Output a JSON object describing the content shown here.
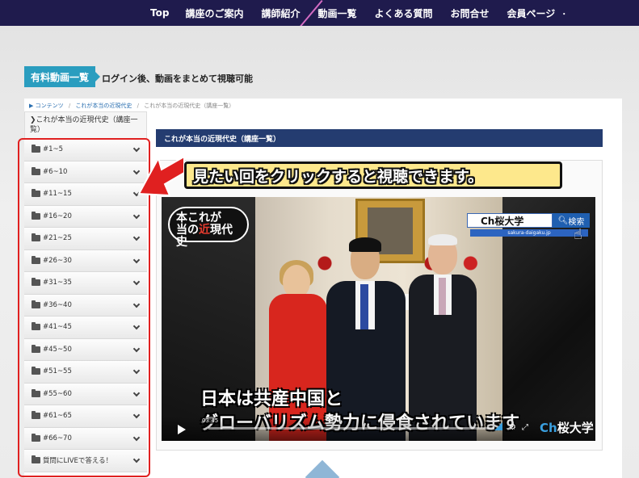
{
  "nav": {
    "items": [
      "Top",
      "講座のご案内",
      "講師紹介",
      "動画一覧",
      "よくある質問",
      "お問合せ",
      "会員ページ"
    ],
    "dot": "・"
  },
  "header": {
    "badge": "有料動画一覧",
    "headline": "ログイン後、動画をまとめて視聴可能"
  },
  "breadcrumb": {
    "home": "▶ コンテンツ",
    "sep": "/",
    "parent": "これが本当の近現代史",
    "current": "これが本当の近現代史（講座一覧）"
  },
  "sidebar": {
    "heading": "❯これが本当の近現代史（講座一覧）",
    "items": [
      "#1~5",
      "#6~10",
      "#11~15",
      "#16~20",
      "#21~25",
      "#26~30",
      "#31~35",
      "#36~40",
      "#41~45",
      "#45~50",
      "#51~55",
      "#55~60",
      "#61~65",
      "#66~70",
      "質問にLIVEで答える！"
    ]
  },
  "main": {
    "title": "これが本当の近現代史（講座一覧）",
    "callout": "見たい回をクリックすると視聴できます。"
  },
  "video": {
    "show_logo_line1": "本これが",
    "show_logo_line2": "当の近現代史",
    "show_logo_kin": "近",
    "search_term": "Ch桜大学",
    "search_button": "検索",
    "search_url": "sakura-daigaku.jp",
    "subtitle_line1": "日本は共産中国と",
    "subtitle_line2": "グローバリズム勢力に侵食されています",
    "time": "03:45",
    "channel_prefix": "Ch",
    "channel_name": "桜大学"
  },
  "colors": {
    "nav_bg": "#1f1b4d",
    "badge": "#2a9dbf",
    "main_title_bg": "#243c70",
    "highlight_red": "#e02020",
    "callout_bg": "#fde88c"
  },
  "icons": {
    "folder": "folder-icon",
    "chevron": "chevron-down-icon",
    "arrow": "red-arrow-icon",
    "play": "play-icon",
    "search": "search-icon",
    "hand": "hand-pointer-icon"
  }
}
